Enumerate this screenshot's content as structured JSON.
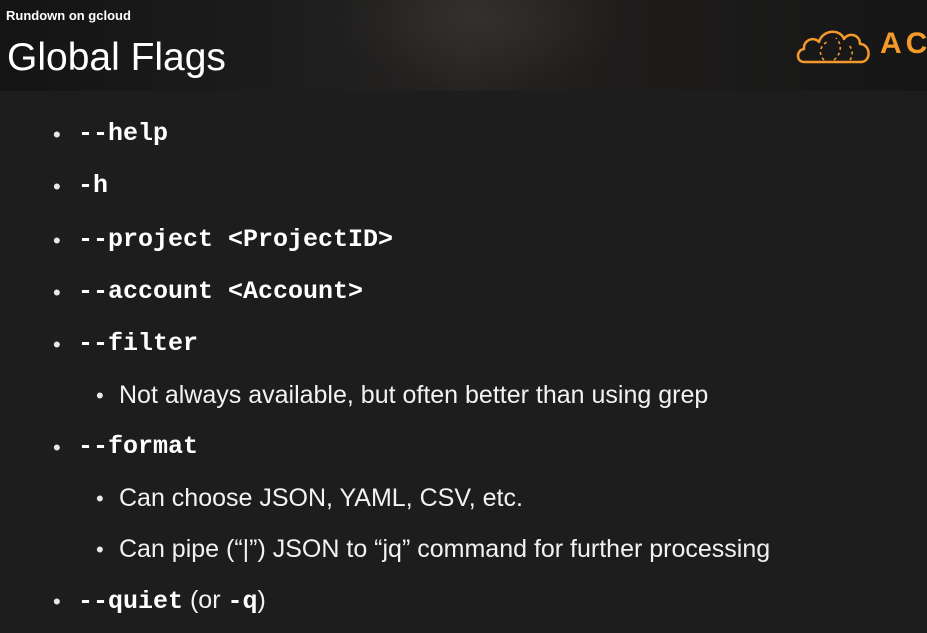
{
  "header": {
    "subtitle": "Rundown on gcloud",
    "title": "Global Flags",
    "logo_text": "AC",
    "accent_color": "#f39a2b"
  },
  "flags": {
    "help": "--help",
    "h": "-h",
    "project": "--project <ProjectID>",
    "account": "--account <Account>",
    "filter": "--filter",
    "filter_note": "Not always available, but often better than using grep",
    "format": "--format",
    "format_note_1": "Can choose JSON, YAML, CSV, etc.",
    "format_note_2": "Can pipe (“|”) JSON to “jq” command for further processing",
    "quiet": "--quiet",
    "quiet_open": " (or ",
    "quiet_short": "-q",
    "quiet_close": ")"
  },
  "bullet_symbol": "•"
}
